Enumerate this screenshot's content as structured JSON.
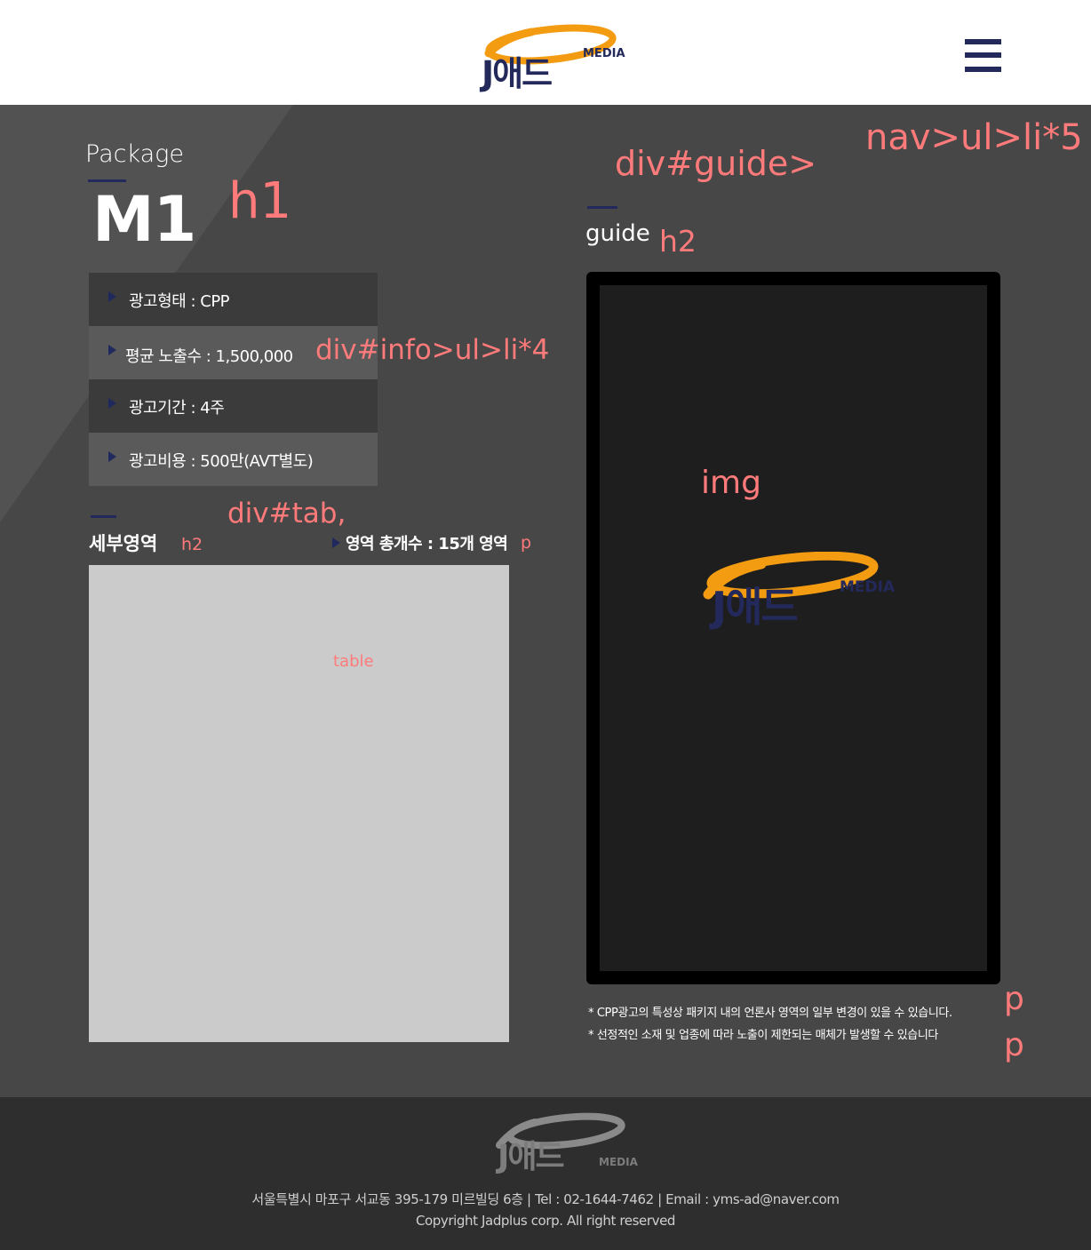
{
  "header": {
    "logo_text": "J애드",
    "logo_sub": "MEDIA",
    "menu_icon": "hamburger-icon"
  },
  "annotations": {
    "nav": "nav>ul>li*5",
    "guide_div": "div#guide>",
    "h1": "h1",
    "info": "div#info>ul>li*4",
    "tab": "div#tab,",
    "h2_detail": "h2",
    "p_count": "p",
    "table": "table",
    "h2_guide": "h2",
    "img": "img",
    "p1": "p",
    "p2": "p"
  },
  "package": {
    "label": "Package",
    "title": "M1"
  },
  "info_items": [
    {
      "label": "광고형태 : CPP"
    },
    {
      "label": "평균 노출수 : 1,500,000"
    },
    {
      "label": "광고기간 : 4주"
    },
    {
      "label": "광고비용 : 500만(AVT별도)"
    }
  ],
  "detail": {
    "title": "세부영역",
    "count_text": "영역 총개수 : 15개 영역"
  },
  "guide": {
    "title": "guide",
    "image_logo_text": "J애드",
    "image_logo_sub": "MEDIA",
    "notes": [
      "* CPP광고의 특성상 패키지 내의 언론사 영역의 일부 변경이 있을 수 있습니다.",
      "* 선정적인 소재 및 업종에 따라 노출이 제한되는 매체가 발생할 수 있습니다"
    ]
  },
  "footer": {
    "logo_text": "J애드",
    "logo_sub": "MEDIA",
    "address": "서울특별시 마포구 서교동 395-179 미르빌딩 6층 | Tel : 02-1644-7462 | Email : yms-ad@naver.com",
    "copyright": "Copyright Jadplus corp. All right reserved"
  },
  "colors": {
    "accent_navy": "#23295a",
    "logo_orange": "#f39c12",
    "annotation": "#ff7a7a",
    "row_dark": "#3b3b3b",
    "row_light": "#5a5a5a"
  }
}
